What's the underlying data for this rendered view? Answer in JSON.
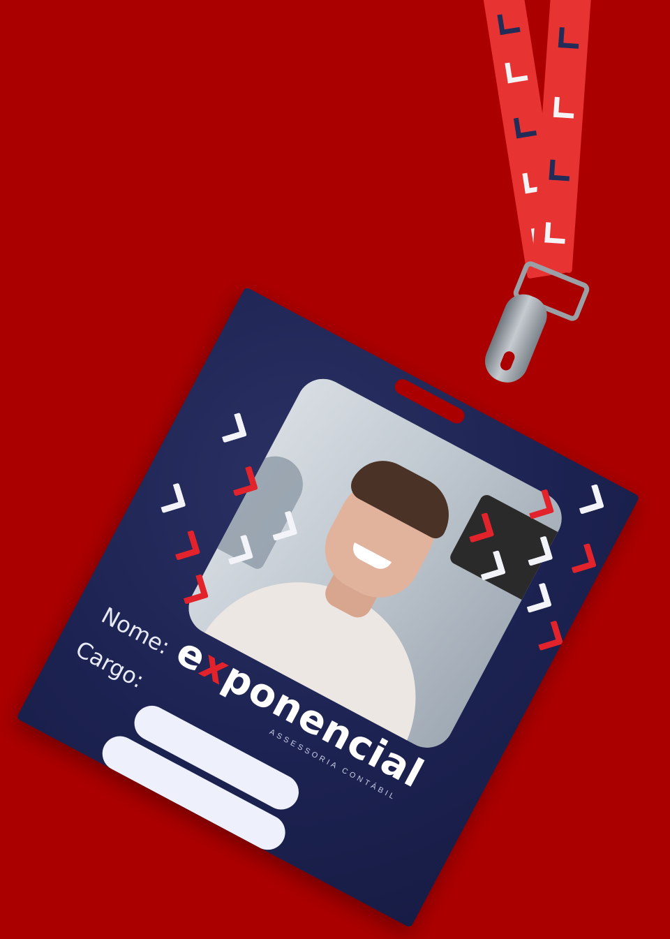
{
  "badge": {
    "brand_prefix": "e",
    "brand_x": "x",
    "brand_suffix": "ponencial",
    "tagline": "ASSESSORIA CONTÁBIL",
    "name_label": "Nome:",
    "role_label": "Cargo:"
  },
  "colors": {
    "background": "#ab0000",
    "card": "#1d2352",
    "accent_red": "#e3232c",
    "lanyard": "#e83333",
    "field": "#eef0fb"
  },
  "icons": [
    "chevron-pattern",
    "lanyard-clip"
  ]
}
